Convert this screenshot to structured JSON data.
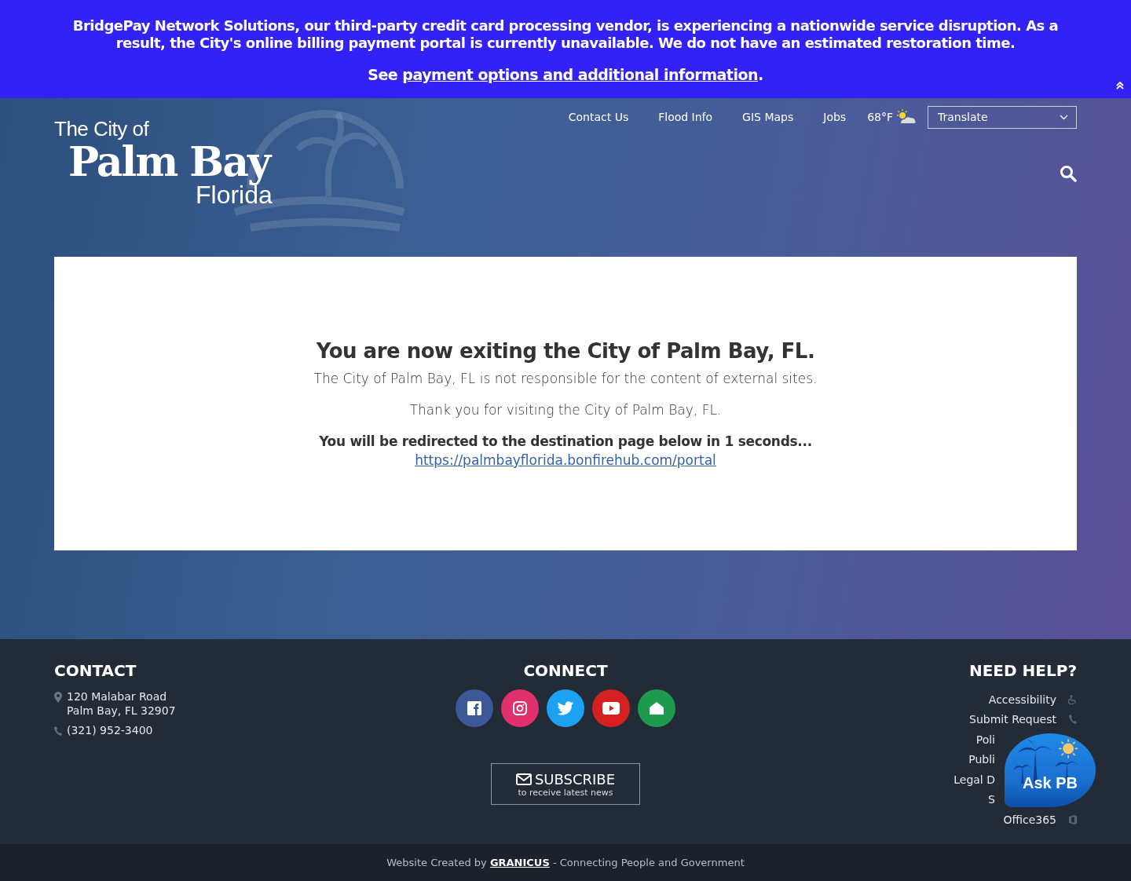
{
  "alert_banner": {
    "message": "BridgePay Network Solutions, our third-party credit card processing vendor, is experiencing a nationwide service disruption. As a result, the City's online billing payment portal is currently unavailable. We do not have an estimated restoration time.",
    "link_prefix": "See ",
    "link_text": "payment options and additional information",
    "link_suffix": "."
  },
  "logo": {
    "line_1": "The City of",
    "line_2": "Palm Bay",
    "line_3": "Florida"
  },
  "top_nav": [
    {
      "label": "Contact Us"
    },
    {
      "label": "Flood Info"
    },
    {
      "label": "GIS Maps"
    },
    {
      "label": "Jobs"
    }
  ],
  "weather": {
    "temperature": "68°F"
  },
  "translate": {
    "label": "Translate"
  },
  "notice": {
    "heading": "You are now exiting the City of Palm Bay, FL.",
    "disclaimer": "The City of Palm Bay, FL is not responsible for the content of external sites.",
    "thanks": "Thank you for visiting the City of Palm Bay, FL.",
    "redirect": "You will be redirected to the destination page below in 1 seconds...",
    "url": "https://palmbayflorida.bonfirehub.com/portal"
  },
  "footer": {
    "contact": {
      "heading": "CONTACT",
      "address_line_1": "120 Malabar Road",
      "address_line_2": "Palm Bay, FL 32907",
      "phone": "(321) 952-3400"
    },
    "connect": {
      "heading": "CONNECT",
      "social": [
        {
          "kind": "facebook",
          "color": "#3b5998"
        },
        {
          "kind": "instagram",
          "color": "#e1306c"
        },
        {
          "kind": "twitter",
          "color": "#1da1f2"
        },
        {
          "kind": "youtube",
          "color": "#d62020"
        },
        {
          "kind": "nextdoor",
          "color": "#1e9a4f"
        }
      ],
      "subscribe_label": "SUBSCRIBE",
      "subscribe_sub": "to receive latest news"
    },
    "help": {
      "heading": "NEED HELP?",
      "links": [
        {
          "label": "Accessibility",
          "kind": "accessibility"
        },
        {
          "label": "Submit Request",
          "kind": "phone"
        },
        {
          "label": "Poli",
          "kind": "covered"
        },
        {
          "label": "Publi",
          "kind": "covered"
        },
        {
          "label": "Legal D",
          "kind": "covered"
        },
        {
          "label": "S",
          "kind": "covered"
        },
        {
          "label": "Office365",
          "kind": "office"
        }
      ]
    }
  },
  "chat_widget": {
    "label": "Ask PB"
  },
  "credit": {
    "prefix": "Website Created by ",
    "brand": "GRANICUS",
    "suffix": " - Connecting People and Government"
  }
}
